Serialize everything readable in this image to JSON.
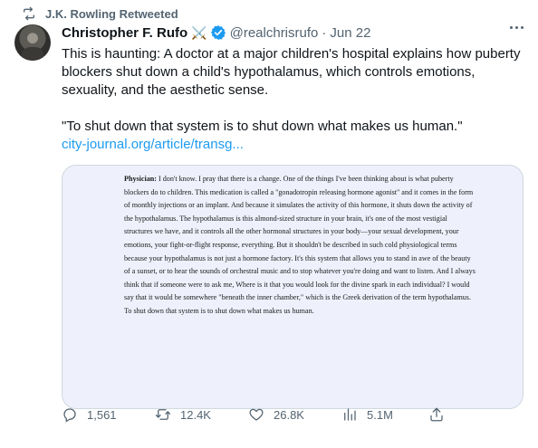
{
  "retweet_banner": "J.K. Rowling Retweeted",
  "author": {
    "name": "Christopher F. Rufo",
    "emoji": "⚔️",
    "handle": "@realchrisrufo",
    "date": "Jun 22"
  },
  "tweet": {
    "text": "This is haunting: A doctor at a major children's hospital explains how puberty blockers shut down a child's hypothalamus, which controls emotions, sexuality, and the aesthetic sense.",
    "quote": "\"To shut down that system is to shut down what makes us human.\"",
    "link": "city-journal.org/article/transg..."
  },
  "media": {
    "speaker": "Physician:",
    "body": "I don't know. I pray that there is a change. One of the things I've been thinking about is what puberty blockers do to children. This medication is called a \"gonadotropin releasing hormone agonist\" and it comes in the form of monthly injections or an implant. And because it simulates the activity of this hormone, it shuts down the activity of the hypothalamus. The hypothalamus is this almond-sized structure in your brain, it's one of the most vestigial structures we have, and it controls all the other hormonal structures in your body—your sexual development, your emotions, your fight-or-flight response, everything. But it shouldn't be described in such cold physiological terms because your hypothalamus is not just a hormone factory. It's this system that allows you to stand in awe of the beauty of a sunset, or to hear the sounds of orchestral music and to stop whatever you're doing and want to listen. And I always think that if someone were to ask me, Where is it that you would look for the divine spark in each individual? I would say that it would be somewhere \"beneath the inner chamber,\" which is the Greek derivation of the term hypothalamus. To shut down that system is to shut down what makes us human."
  },
  "actions": {
    "replies": "1,561",
    "retweets": "12.4K",
    "likes": "26.8K",
    "views": "5.1M"
  },
  "colors": {
    "link": "#1d9bf0",
    "verified": "#1d9bf0",
    "secondary_text": "#536471",
    "media_background": "#eef0fb"
  },
  "icons": [
    "retweet-icon",
    "verified-badge-icon",
    "more-icon",
    "reply-icon",
    "retweet-icon",
    "like-icon",
    "views-icon",
    "share-icon"
  ]
}
